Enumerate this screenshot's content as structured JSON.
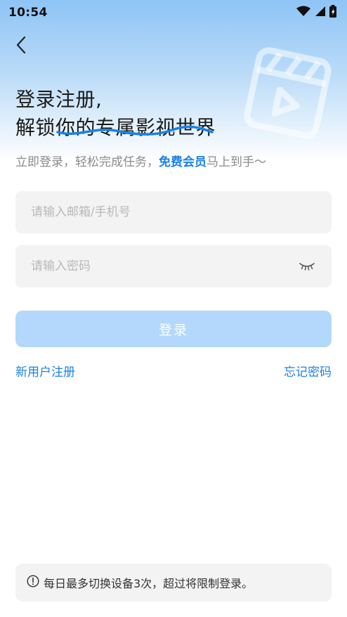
{
  "status_bar": {
    "time": "10:54",
    "icons": [
      "wifi-icon",
      "signal-icon",
      "battery-icon"
    ]
  },
  "header": {
    "back_icon": "back-arrow-icon",
    "title_line1": "登录注册,",
    "title_line2": "解锁你的专属影视世界",
    "subtitle_prefix": "立即登录，轻松完成任务，",
    "subtitle_highlight": "免费会员",
    "subtitle_suffix": "马上到手～"
  },
  "form": {
    "account_placeholder": "请输入邮箱/手机号",
    "account_value": "",
    "password_placeholder": "请输入密码",
    "password_value": "",
    "eye_icon": "eye-closed-icon",
    "login_label": "登录"
  },
  "links": {
    "register": "新用户注册",
    "forgot_password": "忘记密码"
  },
  "notice": {
    "icon": "info-icon",
    "text": "每日最多切换设备3次，超过将限制登录。"
  },
  "colors": {
    "accent": "#1a82e6",
    "login_button_disabled": "#b3d8fc",
    "input_bg": "#f3f3f3",
    "hero_gradient_top": "#8ec4f6"
  }
}
